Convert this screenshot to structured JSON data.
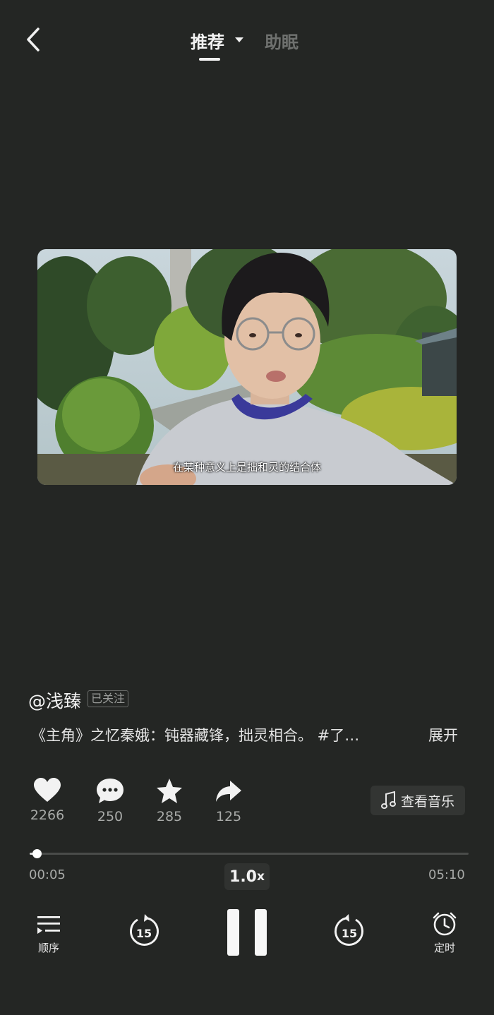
{
  "header": {
    "tabs": [
      {
        "label": "推荐",
        "active": true
      },
      {
        "label": "助眠",
        "active": false
      }
    ]
  },
  "video": {
    "subtitle": "在某种意义上是拙和灵的结合体"
  },
  "post": {
    "author": "@浅臻",
    "follow_status": "已关注",
    "title": "《主角》之忆秦娥：钝器藏锋，拙灵相合。 #了…",
    "expand_label": "展开"
  },
  "actions": {
    "like_count": "2266",
    "comment_count": "250",
    "favorite_count": "285",
    "share_count": "125",
    "music_label": "查看音乐"
  },
  "player": {
    "current_time": "00:05",
    "total_time": "05:10",
    "progress": 0.016,
    "speed": "1.0",
    "speed_suffix": "x",
    "order_label": "顺序",
    "timer_label": "定时",
    "rewind_seconds": "15",
    "forward_seconds": "15"
  },
  "colors": {
    "background": "#242624",
    "text_secondary": "#a8aaa8",
    "tab_inactive": "#6f716f"
  }
}
